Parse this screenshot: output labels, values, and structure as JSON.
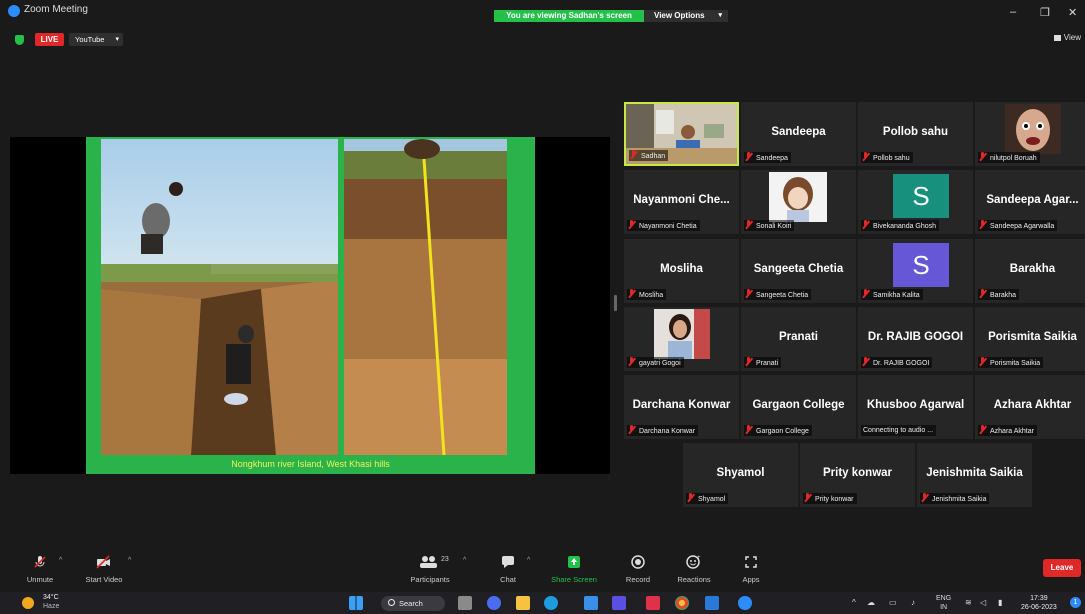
{
  "window": {
    "title": "Zoom Meeting",
    "banner": "You are viewing Sadhan's screen",
    "view_options": "View Options",
    "minimize": "–",
    "maximize": "❐",
    "close": "✕"
  },
  "topbar": {
    "live": "LIVE",
    "youtube": "YouTube",
    "view": "View"
  },
  "slide": {
    "caption": "Nongkhum river Island, West Khasi hills"
  },
  "participants": [
    {
      "display": "",
      "label": "Sadhan",
      "kind": "photo-sadhan",
      "active": true
    },
    {
      "display": "Sandeepa",
      "label": "Sandeepa",
      "kind": "name"
    },
    {
      "display": "Pollob sahu",
      "label": "Pollob sahu",
      "kind": "name"
    },
    {
      "display": "",
      "label": "nilutpol Boruah",
      "kind": "photo-face"
    },
    {
      "display": "Nayanmoni Che...",
      "label": "Nayanmoni Chetia",
      "kind": "name"
    },
    {
      "display": "",
      "label": "Sonali Koiri",
      "kind": "photo-doll"
    },
    {
      "display": "S",
      "label": "Bivekananda Ghosh",
      "kind": "avatar-teal"
    },
    {
      "display": "Sandeepa Agar...",
      "label": "Sandeepa Agarwalla",
      "kind": "name"
    },
    {
      "display": "Mosliha",
      "label": "Mosliha",
      "kind": "name"
    },
    {
      "display": "Sangeeta Chetia",
      "label": "Sangeeta Chetia",
      "kind": "name"
    },
    {
      "display": "S",
      "label": "Samikha Kalita",
      "kind": "avatar-purple"
    },
    {
      "display": "Barakha",
      "label": "Barakha",
      "kind": "name"
    },
    {
      "display": "",
      "label": "gayatri Gogoi",
      "kind": "photo-woman"
    },
    {
      "display": "Pranati",
      "label": "Pranati",
      "kind": "name"
    },
    {
      "display": "Dr. RAJIB GOGOI",
      "label": "Dr. RAJIB GOGOI",
      "kind": "name"
    },
    {
      "display": "Porismita Saikia",
      "label": "Porismita Saikia",
      "kind": "name"
    },
    {
      "display": "Darchana Konwar",
      "label": "Darchana Konwar",
      "kind": "name"
    },
    {
      "display": "Gargaon College",
      "label": "Gargaon College",
      "kind": "name"
    },
    {
      "display": "Khusboo Agarwal",
      "label": "Connecting to audio ...",
      "kind": "name-nomic"
    },
    {
      "display": "Azhara Akhtar",
      "label": "Azhara Akhtar",
      "kind": "name"
    },
    {
      "display": "Shyamol",
      "label": "Shyamol",
      "kind": "name"
    },
    {
      "display": "Prity konwar",
      "label": "Prity konwar",
      "kind": "name"
    },
    {
      "display": "Jenishmita Saikia",
      "label": "Jenishmita Saikia",
      "kind": "name"
    }
  ],
  "toolbar": {
    "unmute": "Unmute",
    "start_video": "Start Video",
    "participants": "Participants",
    "participants_count": "23",
    "chat": "Chat",
    "share_screen": "Share Screen",
    "record": "Record",
    "reactions": "Reactions",
    "apps": "Apps",
    "leave": "Leave"
  },
  "taskbar": {
    "temp": "34°C",
    "weather": "Haze",
    "search": "Search",
    "lang1": "ENG",
    "lang2": "IN",
    "time": "17:39",
    "date": "26-06-2023",
    "notifications": "1"
  },
  "colors": {
    "accent_green": "#23c14a",
    "live_red": "#e02828",
    "active_speaker": "#c7e84a",
    "caption_yellow": "#f1f25a"
  }
}
